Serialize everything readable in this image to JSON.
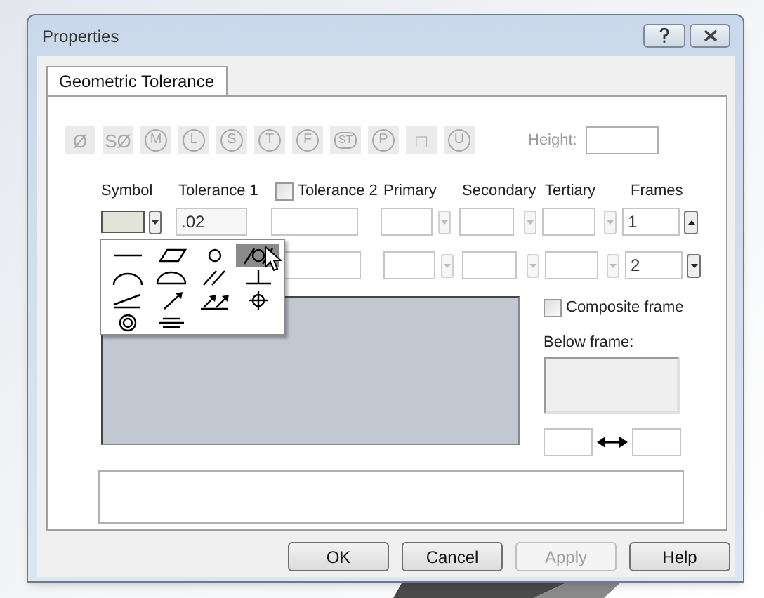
{
  "window": {
    "title": "Properties"
  },
  "tabs": [
    {
      "label": "Geometric Tolerance",
      "selected": true
    }
  ],
  "modifiers": [
    {
      "glyph": "Ø",
      "kind": "plain",
      "disabled": true
    },
    {
      "glyph": "SØ",
      "kind": "plain",
      "disabled": true
    },
    {
      "glyph": "M",
      "kind": "circle",
      "disabled": true
    },
    {
      "glyph": "L",
      "kind": "circle",
      "disabled": true
    },
    {
      "glyph": "S",
      "kind": "circle",
      "disabled": true
    },
    {
      "glyph": "T",
      "kind": "circle",
      "disabled": true
    },
    {
      "glyph": "F",
      "kind": "circle",
      "disabled": true
    },
    {
      "glyph": "ST",
      "kind": "hexagon",
      "disabled": true
    },
    {
      "glyph": "P",
      "kind": "circle",
      "disabled": true
    },
    {
      "glyph": "□",
      "kind": "plain",
      "disabled": true
    },
    {
      "glyph": "U",
      "kind": "circle",
      "disabled": true
    }
  ],
  "height": {
    "label": "Height:"
  },
  "columns": {
    "symbol": "Symbol",
    "tolerance_1": "Tolerance 1",
    "tolerance_2": {
      "label": "Tolerance 2",
      "checked": false
    },
    "primary": "Primary",
    "secondary": "Secondary",
    "tertiary": "Tertiary",
    "frames": "Frames"
  },
  "rows": [
    {
      "tolerance_1": ".02",
      "frames": "1",
      "kind": "up"
    },
    {
      "frames": "2",
      "kind": "down"
    }
  ],
  "symbol_menu": {
    "items": [
      {
        "kind": "straightness",
        "selected": false
      },
      {
        "kind": "flatness",
        "selected": false
      },
      {
        "kind": "circularity",
        "selected": false
      },
      {
        "kind": "cylindricity",
        "selected": true
      },
      {
        "kind": "profile_line",
        "selected": false
      },
      {
        "kind": "profile_surface",
        "selected": false
      },
      {
        "kind": "parallelism",
        "selected": false
      },
      {
        "kind": "perpendicularity",
        "selected": false
      },
      {
        "kind": "angularity",
        "selected": false
      },
      {
        "kind": "circular_runout",
        "selected": false
      },
      {
        "kind": "total_runout",
        "selected": false
      },
      {
        "kind": "position",
        "selected": false
      },
      {
        "kind": "concentricity",
        "selected": false
      },
      {
        "kind": "symmetry",
        "selected": false
      }
    ]
  },
  "composite_frame": {
    "label": "Composite frame",
    "checked": false
  },
  "below_frame": {
    "label": "Below frame:"
  },
  "buttons": [
    {
      "label": "OK",
      "disabled": false
    },
    {
      "label": "Cancel",
      "disabled": false
    },
    {
      "label": "Apply",
      "disabled": true
    },
    {
      "label": "Help",
      "disabled": false
    }
  ]
}
